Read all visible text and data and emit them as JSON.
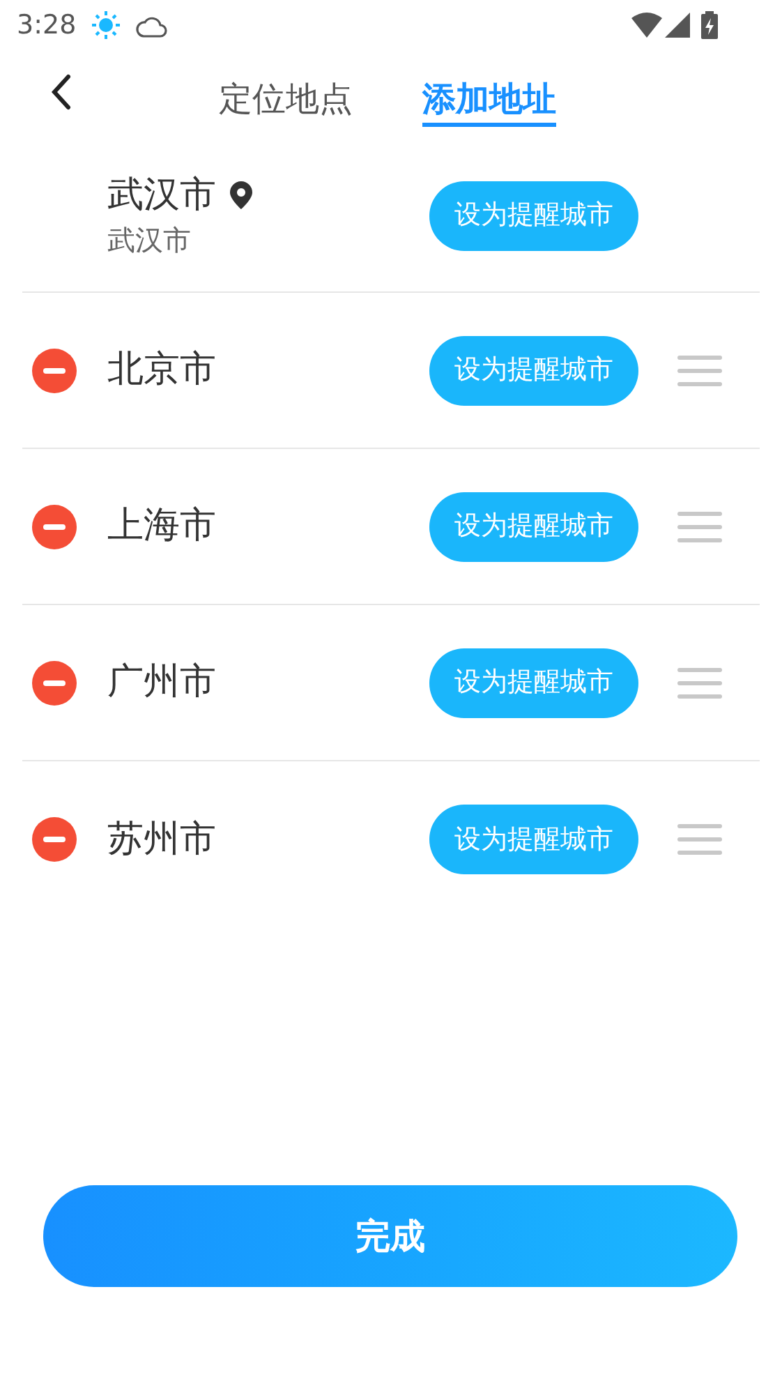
{
  "status_bar": {
    "time": "3:28"
  },
  "tabs": [
    {
      "label": "定位地点",
      "selected": false
    },
    {
      "label": "添加地址",
      "selected": true
    }
  ],
  "located_city": {
    "name": "武汉市",
    "subtitle": "武汉市",
    "button": "设为提醒城市"
  },
  "cities": [
    {
      "name": "北京市",
      "button": "设为提醒城市"
    },
    {
      "name": "上海市",
      "button": "设为提醒城市"
    },
    {
      "name": "广州市",
      "button": "设为提醒城市"
    },
    {
      "name": "苏州市",
      "button": "设为提醒城市"
    }
  ],
  "done_button": "完成"
}
